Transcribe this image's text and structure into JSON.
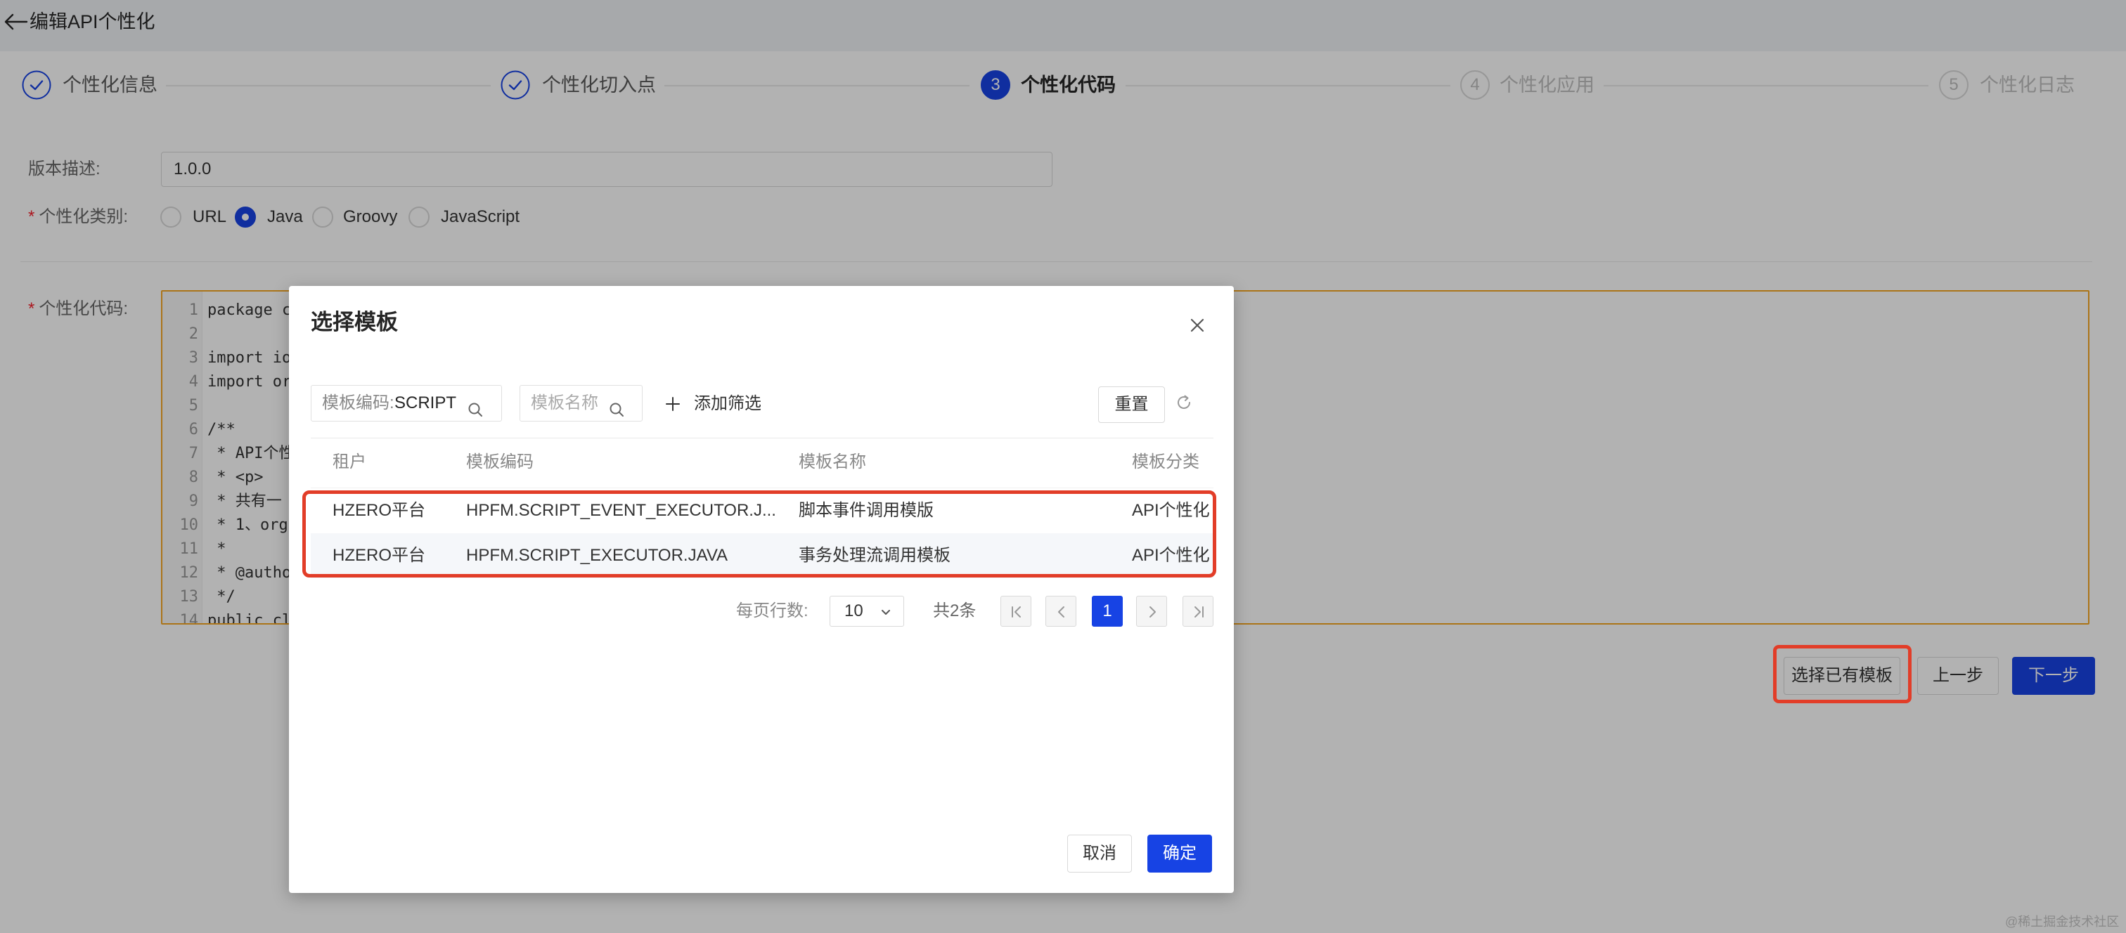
{
  "header": {
    "title": "编辑API个性化"
  },
  "steps": [
    {
      "label": "个性化信息"
    },
    {
      "label": "个性化切入点"
    },
    {
      "num": "3",
      "label": "个性化代码"
    },
    {
      "num": "4",
      "label": "个性化应用"
    },
    {
      "num": "5",
      "label": "个性化日志"
    }
  ],
  "current_step": 3,
  "form": {
    "required_mark": "*",
    "version": {
      "label": "版本描述:",
      "value": "1.0.0"
    },
    "type": {
      "label": "个性化类别:",
      "options": [
        "URL",
        "Java",
        "Groovy",
        "JavaScript"
      ],
      "selected_index": 1
    },
    "code": {
      "label": "个性化代码:",
      "lines": [
        {
          "n": "1",
          "text": "package c"
        },
        {
          "n": "2",
          "text": ""
        },
        {
          "n": "3",
          "text": "import io"
        },
        {
          "n": "4",
          "text": "import or"
        },
        {
          "n": "5",
          "text": ""
        },
        {
          "n": "6",
          "text": "/**"
        },
        {
          "n": "7",
          "text": " * API个性"
        },
        {
          "n": "8",
          "text": " * <p>"
        },
        {
          "n": "9",
          "text": " * 共有一"
        },
        {
          "n": "10",
          "text": " * 1、org"
        },
        {
          "n": "11",
          "text": " *"
        },
        {
          "n": "12",
          "text": " * @autho"
        },
        {
          "n": "13",
          "text": " */"
        },
        {
          "n": "14",
          "text": "public cl"
        }
      ]
    }
  },
  "actions": {
    "select_template": "选择已有模板",
    "prev": "上一步",
    "next": "下一步"
  },
  "modal": {
    "title": "选择模板",
    "filter": {
      "code_label": "模板编码:",
      "code_value": "SCRIPT",
      "name_placeholder": "模板名称",
      "add_filter": "添加筛选",
      "reset": "重置"
    },
    "columns": [
      "租户",
      "模板编码",
      "模板名称",
      "模板分类"
    ],
    "rows": [
      [
        "HZERO平台",
        "HPFM.SCRIPT_EVENT_EXECUTOR.J...",
        "脚本事件调用模版",
        "API个性化"
      ],
      [
        "HZERO平台",
        "HPFM.SCRIPT_EXECUTOR.JAVA",
        "事务处理流调用模板",
        "API个性化"
      ]
    ],
    "pagination": {
      "page_size_label": "每页行数:",
      "page_size": "10",
      "total": "共2条",
      "current_page": "1"
    },
    "cancel": "取消",
    "ok": "确定"
  },
  "watermark": "@稀土掘金技术社区",
  "colors": {
    "primary": "#1743e4",
    "editor_border": "#f5a623",
    "annotation": "#e23d28",
    "required": "#f5222d"
  },
  "icons": [
    "arrow-left-icon",
    "check-circle-icon",
    "close-icon",
    "search-icon",
    "plus-icon",
    "refresh-icon",
    "chevron-down-icon",
    "first-page-icon",
    "prev-page-icon",
    "next-page-icon",
    "last-page-icon"
  ]
}
